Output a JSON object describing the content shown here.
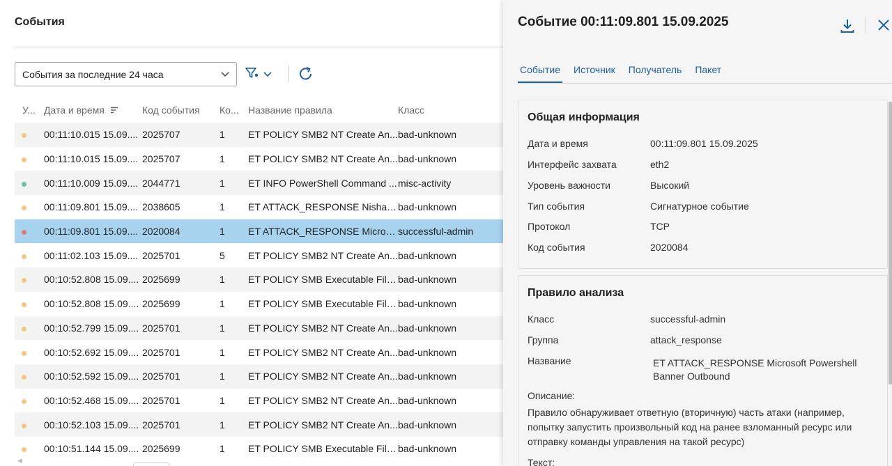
{
  "events_page": {
    "title": "События",
    "period_select": "События за последние 24 часа",
    "columns": [
      "У...",
      "Дата и время",
      "Код события",
      "Ко...",
      "Название правила",
      "Класс"
    ],
    "rows": [
      {
        "color": "#f5c680",
        "datetime": "00:11:10.015 15.09....",
        "code": "2025707",
        "count": "1",
        "rule": "ET POLICY SMB2 NT Create An...",
        "class": "bad-unknown"
      },
      {
        "color": "#f5c680",
        "datetime": "00:11:10.015 15.09....",
        "code": "2025707",
        "count": "1",
        "rule": "ET POLICY SMB2 NT Create An...",
        "class": "bad-unknown"
      },
      {
        "color": "#6cbfa5",
        "datetime": "00:11:10.009 15.09....",
        "code": "2044771",
        "count": "1",
        "rule": "ET INFO PowerShell Command ...",
        "class": "misc-activity"
      },
      {
        "color": "#f5c680",
        "datetime": "00:11:09.801 15.09....",
        "code": "2038605",
        "count": "1",
        "rule": "ET ATTACK_RESPONSE Nishan...",
        "class": "bad-unknown"
      },
      {
        "color": "#e07a7a",
        "datetime": "00:11:09.801 15.09....",
        "code": "2020084",
        "count": "1",
        "rule": "ET ATTACK_RESPONSE Micros...",
        "class": "successful-admin",
        "selected": true
      },
      {
        "color": "#f5c680",
        "datetime": "00:11:02.103 15.09....",
        "code": "2025701",
        "count": "5",
        "rule": "ET POLICY SMB2 NT Create An...",
        "class": "bad-unknown"
      },
      {
        "color": "#f5c680",
        "datetime": "00:10:52.808 15.09....",
        "code": "2025699",
        "count": "1",
        "rule": "ET POLICY SMB Executable File...",
        "class": "bad-unknown"
      },
      {
        "color": "#f5c680",
        "datetime": "00:10:52.808 15.09....",
        "code": "2025699",
        "count": "1",
        "rule": "ET POLICY SMB Executable File...",
        "class": "bad-unknown"
      },
      {
        "color": "#f5c680",
        "datetime": "00:10:52.799 15.09....",
        "code": "2025701",
        "count": "1",
        "rule": "ET POLICY SMB2 NT Create An...",
        "class": "bad-unknown"
      },
      {
        "color": "#f5c680",
        "datetime": "00:10:52.692 15.09....",
        "code": "2025701",
        "count": "1",
        "rule": "ET POLICY SMB2 NT Create An...",
        "class": "bad-unknown"
      },
      {
        "color": "#f5c680",
        "datetime": "00:10:52.592 15.09....",
        "code": "2025701",
        "count": "1",
        "rule": "ET POLICY SMB2 NT Create An...",
        "class": "bad-unknown"
      },
      {
        "color": "#f5c680",
        "datetime": "00:10:52.468 15.09....",
        "code": "2025701",
        "count": "1",
        "rule": "ET POLICY SMB2 NT Create An...",
        "class": "bad-unknown"
      },
      {
        "color": "#f5c680",
        "datetime": "00:10:52.103 15.09....",
        "code": "2025701",
        "count": "1",
        "rule": "ET POLICY SMB2 NT Create An...",
        "class": "bad-unknown"
      },
      {
        "color": "#f5c680",
        "datetime": "00:10:51.144 15.09....",
        "code": "2025699",
        "count": "1",
        "rule": "ET POLICY SMB Executable File...",
        "class": "bad-unknown"
      }
    ]
  },
  "detail": {
    "title": "Событие 00:11:09.801 15.09.2025",
    "tabs": [
      "Событие",
      "Источник",
      "Получатель",
      "Пакет"
    ],
    "general": {
      "title": "Общая информация",
      "fields": [
        {
          "key": "Дата и время",
          "value": "00:11:09.801 15.09.2025"
        },
        {
          "key": "Интерфейс захвата",
          "value": "eth2"
        },
        {
          "key": "Уровень важности",
          "value": "Высокий"
        },
        {
          "key": "Тип события",
          "value": "Сигнатурное событие"
        },
        {
          "key": "Протокол",
          "value": "TCP"
        },
        {
          "key": "Код события",
          "value": "2020084"
        }
      ]
    },
    "rule": {
      "title": "Правило анализа",
      "fields": [
        {
          "key": "Класс",
          "value": "successful-admin"
        },
        {
          "key": "Группа",
          "value": "attack_response"
        }
      ],
      "name_key": "Название",
      "name_line1": "ET ATTACK_RESPONSE Microsoft Powershell",
      "name_line2": "Banner Outbound",
      "desc_label": "Описание:",
      "desc_line1": "Правило обнаруживает ответную (вторичную) часть атаки (например,",
      "desc_line2": "попытку запустить произвольный код на ранее взломанный ресурс или",
      "desc_line3": "отправку команды управления на такой ресурс)",
      "text_label": "Текст:"
    }
  },
  "colors": {
    "accent": "#1c5f9a",
    "selected_row": "#a8d3ee",
    "warning": "#f5c680",
    "info": "#6cbfa5",
    "critical": "#e07a7a"
  }
}
